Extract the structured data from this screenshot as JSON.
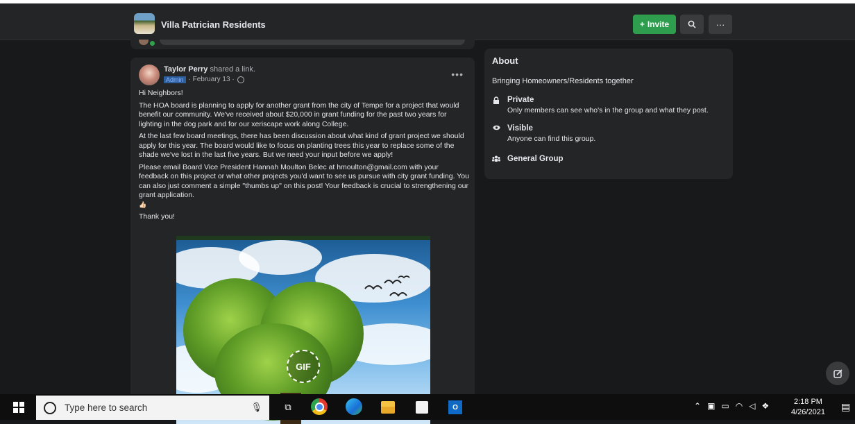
{
  "header": {
    "group_name": "Villa Patrician Residents",
    "invite_label": "Invite",
    "invite_icon": "+",
    "search_icon": "search-icon",
    "more_icon": "more-icon"
  },
  "post": {
    "author": "Taylor Perry",
    "action": "shared a link.",
    "role_badge": "Admin",
    "date": "· February 13 ·",
    "greeting": "Hi Neighbors!",
    "paragraph1": "The HOA board is planning to apply for another grant from the city of Tempe for a project that would benefit our community. We've received about $20,000 in grant funding for the past two years for lighting in the dog park and for our xeriscape work along College.",
    "paragraph2": "At the last few board meetings, there has been discussion about what kind of grant project we should apply for this year. The board would like to focus on planting trees this year to replace some of the shade we've lost in the last five years. But we need your input before we apply!",
    "paragraph3": "Please email Board Vice President Hannah Moulton Belec at hmoulton@gmail.com with your feedback on this project or what other projects you'd want to see us pursue with city grant funding. You can also just comment a simple \"thumbs up\" on this post! Your feedback is crucial to strengthening our grant application.",
    "emoji_line": "👍🏻",
    "signoff": "Thank you!",
    "gif_label": "GIF"
  },
  "about": {
    "title": "About",
    "description": "Bringing Homeowners/Residents together",
    "items": [
      {
        "icon": "lock-icon",
        "title": "Private",
        "subtitle": "Only members can see who's in the group and what they post."
      },
      {
        "icon": "eye-icon",
        "title": "Visible",
        "subtitle": "Anyone can find this group."
      },
      {
        "icon": "group-icon",
        "title": "General Group",
        "subtitle": ""
      }
    ]
  },
  "taskbar": {
    "search_placeholder": "Type here to search",
    "time": "2:18 PM",
    "date": "4/26/2021"
  },
  "colors": {
    "background": "#18191a",
    "card": "#242526",
    "invite_green": "#2e9e4e"
  }
}
